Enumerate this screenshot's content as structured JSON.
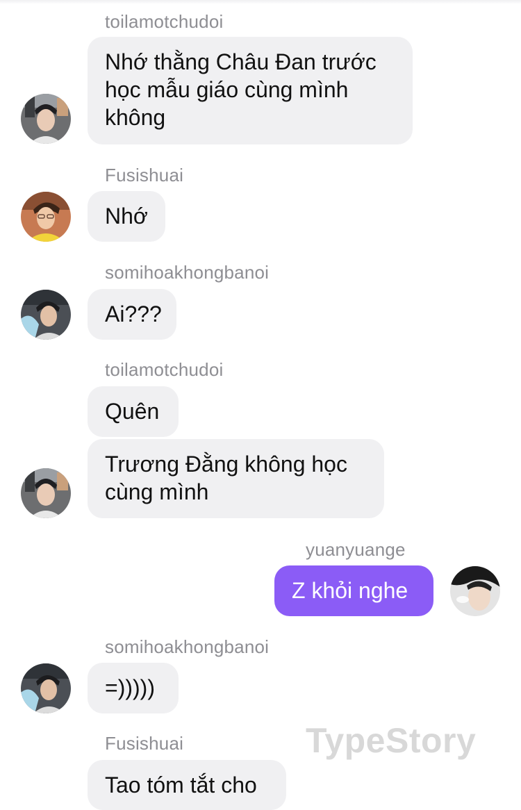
{
  "colors": {
    "received_bubble": "#f0f0f2",
    "sent_bubble": "#8b5cf6",
    "sender_name": "#8e8e93",
    "watermark": "#d8d8d8"
  },
  "messages": [
    {
      "sender": "toilamotchudoi",
      "avatar": "toilamotchudoi-avatar",
      "text": "Nhớ thằng Châu Đan trước học mẫu giáo cùng mình không"
    },
    {
      "sender": "Fusishuai",
      "avatar": "fusishuai-avatar",
      "text": "Nhớ"
    },
    {
      "sender": "somihoakhongbanoi",
      "avatar": "somihoakhongbanoi-avatar",
      "text": "Ai???"
    },
    {
      "sender": "toilamotchudoi",
      "avatar": "toilamotchudoi-avatar",
      "text": "Quên"
    },
    {
      "sender": "toilamotchudoi",
      "text": "Trương Đằng không học cùng mình"
    },
    {
      "sender": "yuanyuange",
      "avatar": "yuanyuange-avatar",
      "text": "Z khỏi nghe",
      "outgoing": true
    },
    {
      "sender": "somihoakhongbanoi",
      "avatar": "somihoakhongbanoi-avatar",
      "text": "=)))))"
    },
    {
      "sender": "Fusishuai",
      "text": "Tao tóm tắt cho"
    }
  ],
  "watermark": "TypeStory"
}
